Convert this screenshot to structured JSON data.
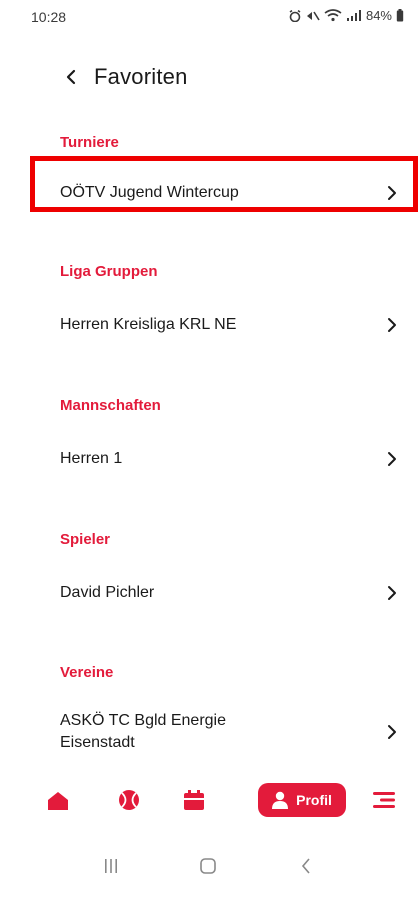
{
  "status": {
    "time": "10:28",
    "battery": "84%"
  },
  "header": {
    "title": "Favoriten"
  },
  "sections": [
    {
      "title": "Turniere",
      "items": [
        "OÖTV Jugend Wintercup"
      ]
    },
    {
      "title": "Liga Gruppen",
      "items": [
        "Herren Kreisliga KRL NE"
      ]
    },
    {
      "title": "Mannschaften",
      "items": [
        "Herren 1"
      ]
    },
    {
      "title": "Spieler",
      "items": [
        "David Pichler"
      ]
    },
    {
      "title": "Vereine",
      "items": [
        "ASKÖ TC Bgld Energie Eisenstadt"
      ]
    }
  ],
  "bottom_nav": {
    "profil_label": "Profil"
  },
  "colors": {
    "accent": "#e31b3b",
    "highlight": "#ee0000"
  },
  "icons": [
    "back-icon",
    "chevron-right-icon",
    "home-icon",
    "tennis-ball-icon",
    "calendar-icon",
    "user-icon",
    "menu-icon"
  ]
}
